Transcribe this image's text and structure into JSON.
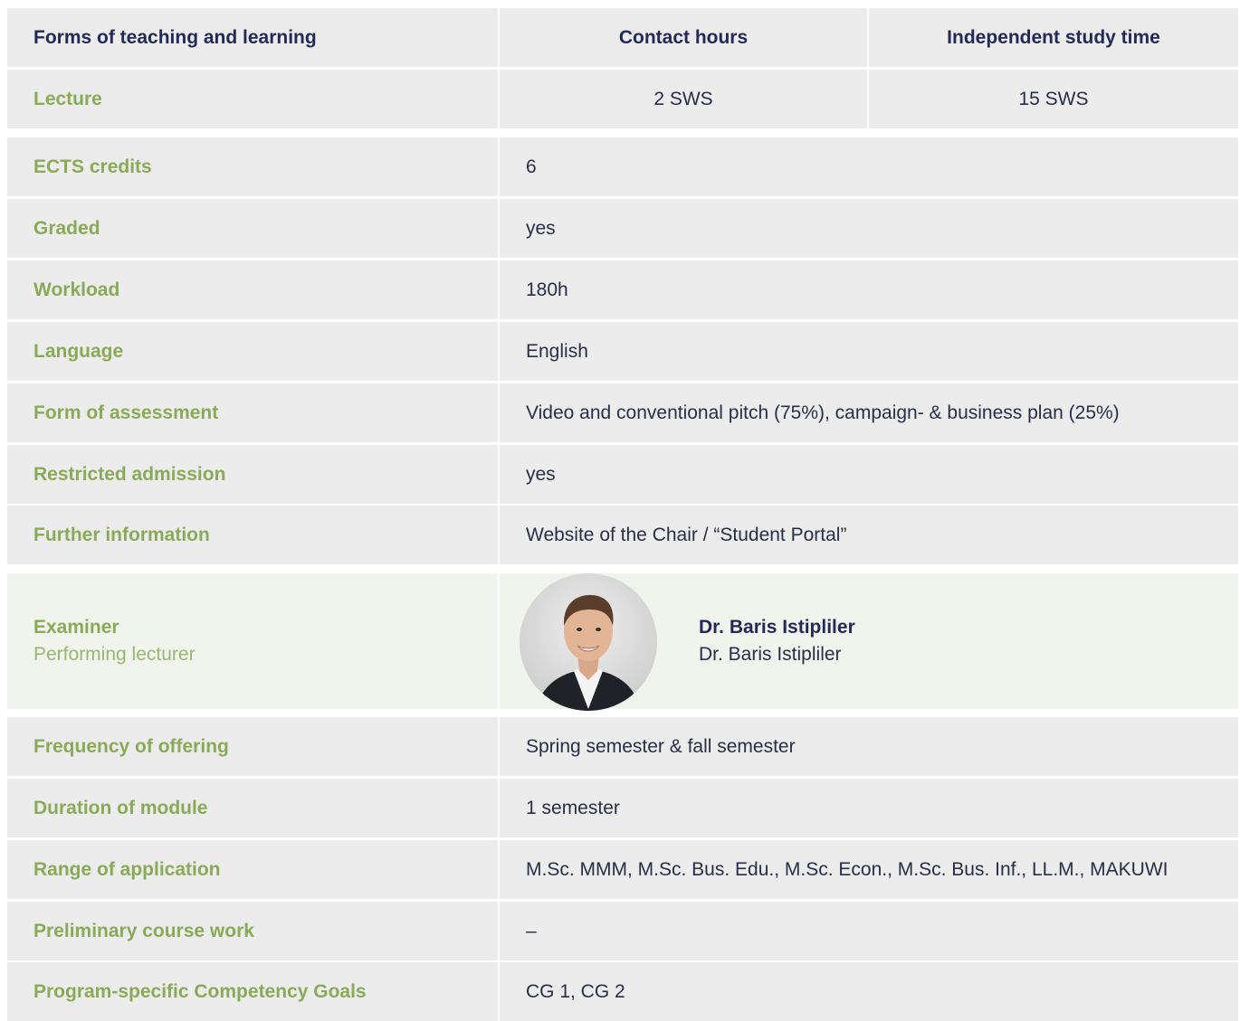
{
  "teaching_table": {
    "header": {
      "forms": "Forms of teaching and learning",
      "contact": "Contact hours",
      "independent": "Independent study time"
    },
    "rows": [
      {
        "form": "Lecture",
        "contact": "2 SWS",
        "independent": "15 SWS"
      }
    ]
  },
  "details": [
    {
      "label": "ECTS credits",
      "value": "6"
    },
    {
      "label": "Graded",
      "value": "yes"
    },
    {
      "label": "Workload",
      "value": "180h"
    },
    {
      "label": "Language",
      "value": "English"
    },
    {
      "label": "Form of assessment",
      "value": "Video and conventional pitch (75%), campaign- & business plan (25%)"
    },
    {
      "label": "Restricted admission",
      "value": "yes"
    },
    {
      "label": "Further information",
      "value": "Website of the Chair / “Student Portal”"
    }
  ],
  "examiner": {
    "label_examiner": "Examiner",
    "label_lecturer": "Performing lecturer",
    "examiner_name": "Dr. Baris Istipliler",
    "lecturer_name": "Dr. Baris Istipliler"
  },
  "details2": [
    {
      "label": "Frequency of offering",
      "value": "Spring semester & fall semester"
    },
    {
      "label": "Duration of module",
      "value": "1 semester"
    },
    {
      "label": "Range of application",
      "value": "M.Sc. MMM, M.Sc. Bus. Edu., M.Sc. Econ., M.Sc. Bus. Inf., LL.M., MAKUWI"
    },
    {
      "label": "Preliminary course work",
      "value": "–"
    },
    {
      "label": "Program-specific Competency Goals",
      "value": "CG 1, CG 2"
    }
  ],
  "colors": {
    "label_green": "#8aaa5a",
    "header_navy": "#252a55",
    "row_gray": "#ececec",
    "examiner_bg": "#f1f4ec"
  }
}
